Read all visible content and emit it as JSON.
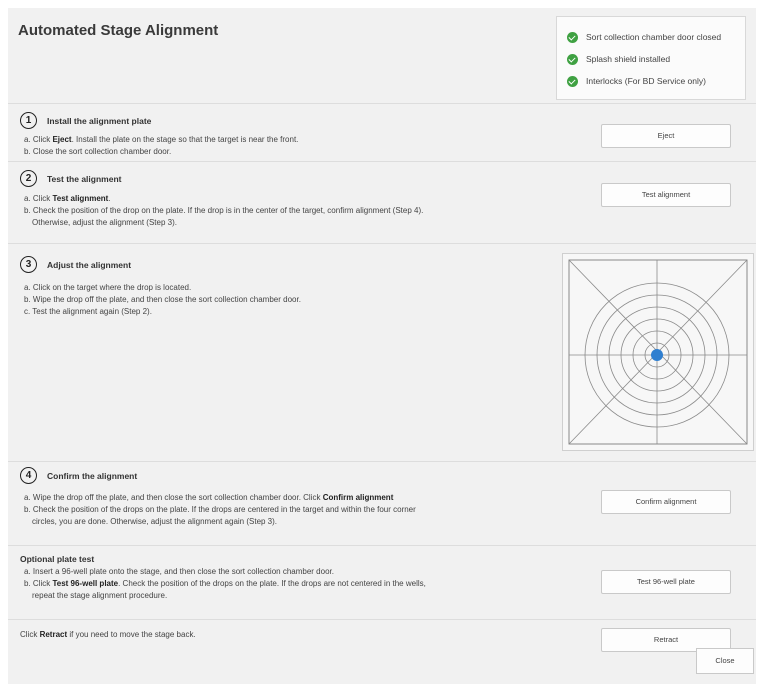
{
  "dialog": {
    "title": "Automated Stage Alignment",
    "close_label": "Close"
  },
  "interlocks": [
    {
      "label": "Sort collection chamber door closed",
      "status": "ok"
    },
    {
      "label": "Splash shield installed",
      "status": "ok"
    },
    {
      "label": "Interlocks (For BD Service only)",
      "status": "ok"
    }
  ],
  "steps": {
    "install": {
      "number": "1",
      "title": "Install the alignment plate",
      "line_a_prefix": "a. Click ",
      "line_a_bold": "Eject",
      "line_a_suffix": ". Install the plate on the stage so that the target is near the front.",
      "line_b": "b. Close the sort collection chamber door.",
      "button": "Eject"
    },
    "test": {
      "number": "2",
      "title": "Test the alignment",
      "line_a_prefix": "a. Click ",
      "line_a_bold": "Test alignment",
      "line_a_suffix": ".",
      "line_b1": "b. Check the position of the drop on the plate. If the drop is in the center of the target, confirm alignment (Step 4).",
      "line_b2": "Otherwise, adjust the alignment (Step 3).",
      "button": "Test alignment"
    },
    "adjust": {
      "number": "3",
      "title": "Adjust the alignment",
      "line_a": "a. Click on the target where the drop is located.",
      "line_b": "b. Wipe the drop off the plate, and then close the sort collection chamber door.",
      "line_c": "c. Test the alignment again (Step 2)."
    },
    "confirm": {
      "number": "4",
      "title": "Confirm the alignment",
      "line_a_prefix": "a. Wipe the drop off the plate, and then close the sort collection chamber door. Click ",
      "line_a_bold": "Confirm alignment",
      "line_b1": "b. Check the position of the drops on the plate. If the drops are centered in the target and within the four corner",
      "line_b2": "circles, you are done. Otherwise, adjust the alignment again (Step 3).",
      "button": "Confirm alignment"
    },
    "optional": {
      "title": "Optional plate test",
      "line_a": "a. Insert a 96-well plate onto the stage, and then close the sort collection chamber door.",
      "line_b_prefix": "b. Click ",
      "line_b_bold": "Test 96-well plate",
      "line_b_suffix": ". Check the position of the drops on the plate. If the drops are not centered in the wells,",
      "line_b2": "repeat the stage alignment procedure.",
      "button": "Test 96-well plate"
    },
    "retract": {
      "prefix": "Click ",
      "bold": "Retract",
      "suffix": " if you need to move the stage back.",
      "button": "Retract"
    }
  },
  "target": {
    "ring_color": "#8a8a8a",
    "drop_color": "#2f7fd0",
    "ring_count": 6
  }
}
